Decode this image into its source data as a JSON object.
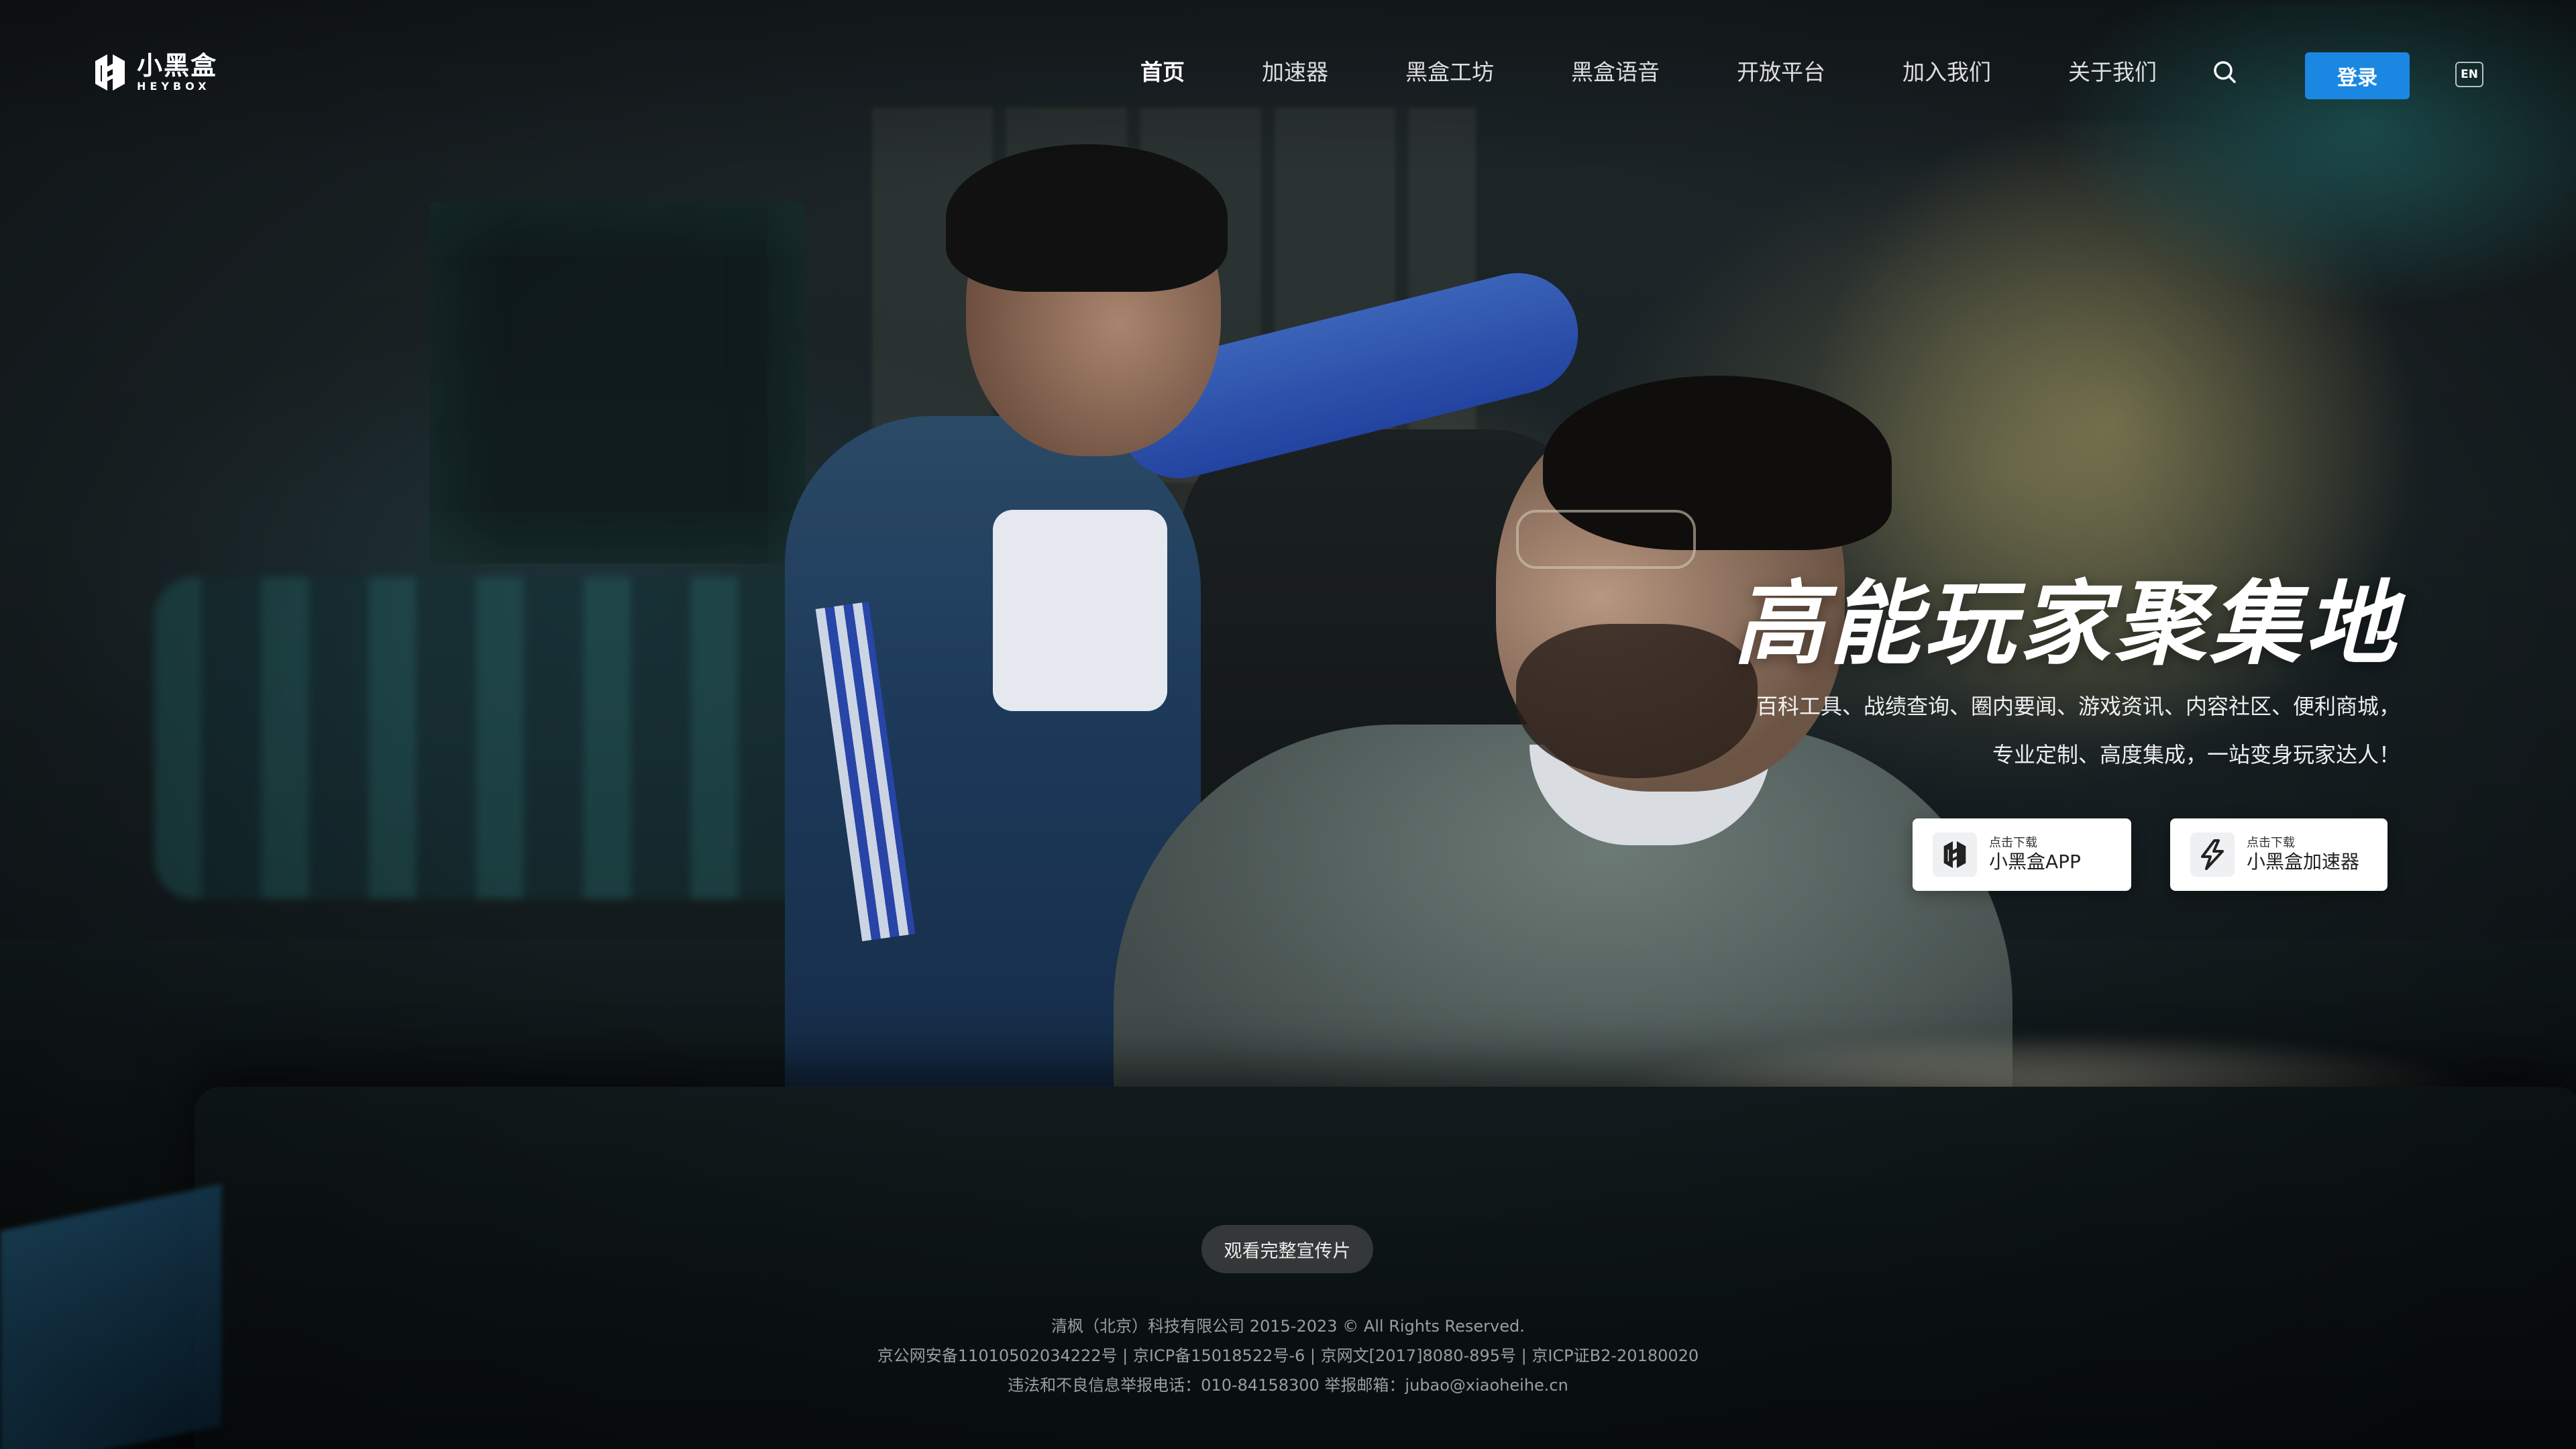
{
  "brand": {
    "name_cn": "小黑盒",
    "name_en": "HEYBOX",
    "accent": "#1a87e2"
  },
  "nav": {
    "items": [
      {
        "label": "首页",
        "active": true
      },
      {
        "label": "加速器",
        "active": false
      },
      {
        "label": "黑盒工坊",
        "active": false
      },
      {
        "label": "黑盒语音",
        "active": false
      },
      {
        "label": "开放平台",
        "active": false
      },
      {
        "label": "加入我们",
        "active": false
      },
      {
        "label": "关于我们",
        "active": false
      }
    ],
    "search_icon": "search-icon",
    "login_label": "登录",
    "lang_label": "EN"
  },
  "hero": {
    "slogan": "高能玩家聚集地",
    "desc_line1": "百科工具、战绩查询、圈内要闻、游戏资讯、内容社区、便利商城，",
    "desc_line2": "专业定制、高度集成，一站变身玩家达人！",
    "downloads": [
      {
        "small": "点击下载",
        "big": "小黑盒APP",
        "icon": "heybox-logo-icon"
      },
      {
        "small": "点击下载",
        "big": "小黑盒加速器",
        "icon": "lightning-icon"
      }
    ]
  },
  "watch_button": "观看完整宣传片",
  "footer": {
    "line1": "清枫（北京）科技有限公司 2015-2023 © All Rights Reserved.",
    "line2": "京公网安备11010502034222号 | 京ICP备15018522号-6 | 京网文[2017]8080-895号 | 京ICP证B2-20180020",
    "line3": "违法和不良信息举报电话：010-84158300    举报邮箱：jubao@xiaoheihe.cn"
  }
}
